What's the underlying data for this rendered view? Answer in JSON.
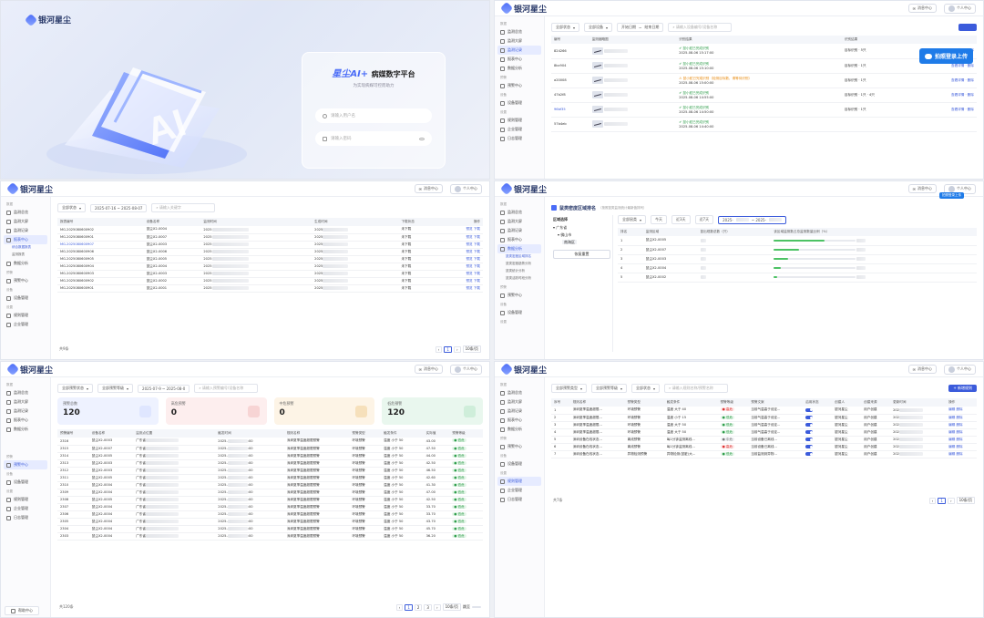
{
  "brand": {
    "name": "银河星尘",
    "accent": "#3b5bdb"
  },
  "login": {
    "title_ai": "星尘AI+",
    "title_rest": "病媒数字平台",
    "subtitle": "为实现病媒可控而助力",
    "username_placeholder": "请输入用户名",
    "password_placeholder": "请输入密码"
  },
  "header": {
    "message_label": "消息中心",
    "user_label": "个人中心"
  },
  "sidebar": {
    "group_data": "数据",
    "group_warn": "预警",
    "group_device": "设备",
    "group_settings": "设置",
    "items": {
      "overview": "监测总览",
      "bigscreen": "监测大屏",
      "records": "监测记录",
      "reports": "报表中心",
      "analysis": "数据分析",
      "warn_center": "预警中心",
      "device_mgmt": "设备管理",
      "rules": "规则管理",
      "enterprise": "企业管理",
      "logs": "日志管理"
    },
    "report_subs": [
      "综合数据报表",
      "监测报表"
    ],
    "analysis_subs": [
      "鼠类密度区域排名",
      "鼠类密度趋势分析",
      "鼠类统计分析",
      "鼠类活跃时段分析"
    ],
    "help": "帮助中心"
  },
  "p_records": {
    "filters": [
      "全部状态",
      "全部设备",
      "开始日期",
      "结束日期"
    ],
    "search_placeholder": "请输入设备编号/设备名称",
    "headers": [
      "编号",
      "监测缩略图",
      "识别结果",
      "",
      "识别结果",
      ""
    ],
    "rows": [
      {
        "id": "824266",
        "status": "鼠小蛇已完成识别",
        "time": "2025-08-06 15:17:00",
        "result": "目标识别 · 5只",
        "actions": "查看 · 删除"
      },
      {
        "id": "8bc904",
        "status": "鼠小蛇已完成识别",
        "time": "2025-08-06 15:10:00",
        "result": "目标识别 · 1只",
        "actions": "查看详情 · 删除"
      },
      {
        "id": "a20008",
        "status": "鼠小蛇已完成识别（检测目标数，请等待识别）",
        "time": "2025-08-06 15:00:00",
        "result": "目标识别 · 1只",
        "actions": "查看详情 · 删除"
      },
      {
        "id": "47b2f8",
        "status": "鼠小蛇已完成识别",
        "time": "2025-08-06 14:55:00",
        "result": "目标识别 · 1只 · 4只",
        "actions": "查看详情 · 删除"
      },
      {
        "id": "96bf35",
        "status": "鼠小蛇已完成识别",
        "time": "2025-08-06 14:50:00",
        "result": "目标识别 · 1只",
        "actions": "查看详情 · 删除"
      },
      {
        "id": "57b4eb",
        "status": "鼠小蛇已完成识别",
        "time": "2025-08-06 14:40:00",
        "result": "",
        "actions": ""
      }
    ],
    "upload_badge": "拍照登录上传"
  },
  "p_reports": {
    "status_filter": "全部状态",
    "date_range": "2025-07-16 ~ 2025-08-07",
    "search_placeholder": "请输入关键字",
    "headers": [
      "报表编号",
      "设备名称",
      "监测时间",
      "生成时间",
      "下载状态",
      "操作"
    ],
    "rows": [
      [
        "MG-2025080600902",
        "鼠尘X2-0004",
        "未下载"
      ],
      [
        "MG-2025080600901",
        "鼠尘X2-0007",
        "未下载"
      ],
      [
        "MG-2025080600907",
        "鼠尘X2-0003",
        "未下载"
      ],
      [
        "MG-2025080600906",
        "鼠尘X2-0006",
        "未下载"
      ],
      [
        "MG-2025080600905",
        "鼠尘X2-0005",
        "未下载"
      ],
      [
        "MG-2025080600904",
        "鼠尘X2-0004",
        "未下载"
      ],
      [
        "MG-2025080600903",
        "鼠尘X2-0003",
        "未下载"
      ],
      [
        "MG-2025080600902",
        "鼠尘X2-0002",
        "未下载"
      ],
      [
        "MG-2025080600901",
        "鼠尘X2-0001",
        "未下载"
      ]
    ],
    "row_actions": [
      "预览",
      "下载"
    ],
    "total": "共9条",
    "page": "1",
    "page_size": "10条/页"
  },
  "p_ranking": {
    "title": "鼠类密度区域排名",
    "hint": "（按照鼠类监测统计最新值排列）",
    "region_label": "区域选择",
    "tree": [
      "广东省",
      "佛山市",
      "南海区"
    ],
    "reset": "恢复重置",
    "type_filter": "全部鼠类",
    "quick": [
      "今天",
      "近3天",
      "近7天"
    ],
    "headers": [
      "排名",
      "监测区域",
      "鼠出现数总数（只）",
      "该区域监测数占总监测数量比例（%）"
    ],
    "rows": [
      {
        "rank": "1",
        "device": "鼠尘X2-0005",
        "ratio": 0.62
      },
      {
        "rank": "2",
        "device": "鼠尘X2-0007",
        "ratio": 0.31
      },
      {
        "rank": "3",
        "device": "鼠尘X2-0003",
        "ratio": 0.18
      },
      {
        "rank": "4",
        "device": "鼠尘X2-0004",
        "ratio": 0.09
      },
      {
        "rank": "5",
        "device": "鼠尘X2-0002",
        "ratio": 0.04
      }
    ],
    "upload_badge": "拍照登录上传"
  },
  "p_warn": {
    "filters": [
      "全部预警状态",
      "全部预警等级"
    ],
    "date_range": "2025-07-9 ~ 2025-08-0",
    "search_placeholder": "请输入预警编号/设备名称",
    "stats": [
      {
        "label": "预警总数",
        "value": "120",
        "bg": "#eef2ff",
        "badge": "#dfe6ff"
      },
      {
        "label": "高危预警",
        "value": "0",
        "bg": "#fdeeee",
        "badge": "#f7d4d4"
      },
      {
        "label": "中危预警",
        "value": "0",
        "bg": "#fdf4e6",
        "badge": "#f6e0bb"
      },
      {
        "label": "低危预警",
        "value": "120",
        "bg": "#e9f7ee",
        "badge": "#cfeeda"
      }
    ],
    "headers": [
      "预警编号",
      "设备名称",
      "监测点位置",
      "触发时间",
      "规则名称",
      "预警类型",
      "触发条件",
      "实际值",
      "预警等级"
    ],
    "rows": [
      [
        "2316",
        "鼠尘X2-0003",
        "43.00"
      ],
      [
        "2315",
        "鼠尘X2-0007",
        "47.50"
      ],
      [
        "2314",
        "鼠尘X2-0005",
        "44.00"
      ],
      [
        "2313",
        "鼠尘X2-0003",
        "42.50"
      ],
      [
        "2312",
        "鼠尘X2-0003",
        "46.50"
      ],
      [
        "2311",
        "鼠尘X2-0005",
        "42.60"
      ],
      [
        "2310",
        "鼠尘X2-0004",
        "41.30"
      ],
      [
        "2309",
        "鼠尘X2-0004",
        "47.00"
      ],
      [
        "2308",
        "鼠尘X2-0005",
        "42.50"
      ],
      [
        "2307",
        "鼠尘X2-0004",
        "33.70"
      ],
      [
        "2306",
        "鼠尘X2-0004",
        "33.70"
      ],
      [
        "2305",
        "鼠尘X2-0004",
        "43.70"
      ],
      [
        "2304",
        "鼠尘X2-0004",
        "45.70"
      ],
      [
        "2303",
        "鼠尘X2-0004",
        "36.20"
      ]
    ],
    "province": "广东省",
    "rule": "深圳夏季温度超限预警",
    "type": "环境预警",
    "cond": "温度 小于 50",
    "level": "低危",
    "total": "共120条",
    "page_size": "10条/页",
    "jump": "跳至"
  },
  "p_rules": {
    "filters": [
      "全部预警类型",
      "全部预警等级",
      "全部状态"
    ],
    "search_placeholder": "请输入规则名称/预警名称",
    "add_button": "+ 新增规则",
    "headers": [
      "序号",
      "规则名称",
      "预警类型",
      "触发条件",
      "预警等级",
      "预警文案",
      "启用状态",
      "创建人",
      "创建来源",
      "更新时间",
      "操作"
    ],
    "rows": [
      {
        "no": "1",
        "name": "深圳夏季温度超限...",
        "type": "环境预警",
        "cond": "温度 大于 40",
        "level": "高危",
        "text": "当前气温高于设定...",
        "creator": "银河星尘",
        "src": "用户创建"
      },
      {
        "no": "2",
        "name": "深圳夏季温度超限...",
        "type": "环境预警",
        "cond": "温度 小于 15",
        "level": "低危",
        "text": "当前气温高于设定...",
        "creator": "银河星尘",
        "src": "用户创建"
      },
      {
        "no": "3",
        "name": "深圳夏季温度超限...",
        "type": "环境预警",
        "cond": "温度 大于 50",
        "level": "低危",
        "text": "当前气温高于设定...",
        "creator": "银河星尘",
        "src": "用户创建"
      },
      {
        "no": "4",
        "name": "深圳夏季温度超限...",
        "type": "环境预警",
        "cond": "温度 大于 50",
        "level": "低危",
        "text": "当前气温高于设定...",
        "creator": "银河星尘",
        "src": "用户创建"
      },
      {
        "no": "5",
        "name": "深圳设备在线状态...",
        "type": "离线预警",
        "cond": "每1分钟监测离线...",
        "level": "中危",
        "text": "当前设备已离线...",
        "creator": "银河星尘",
        "src": "用户创建"
      },
      {
        "no": "6",
        "name": "深圳设备在线状态...",
        "type": "离线预警",
        "cond": "每1分钟监测离线...",
        "level": "高危",
        "text": "当前设备已离线...",
        "creator": "银河星尘",
        "src": "用户创建"
      },
      {
        "no": "7",
        "name": "深圳设备在线状态...",
        "type": "异物检测预警",
        "cond": "异物检测(鼠脏)大...",
        "level": "低危",
        "text": "当前监测到异物...",
        "creator": "银河星尘",
        "src": "用户创建"
      }
    ],
    "row_actions": [
      "编辑",
      "删除"
    ],
    "total": "共7条",
    "page": "1",
    "page_size": "10条/页"
  }
}
